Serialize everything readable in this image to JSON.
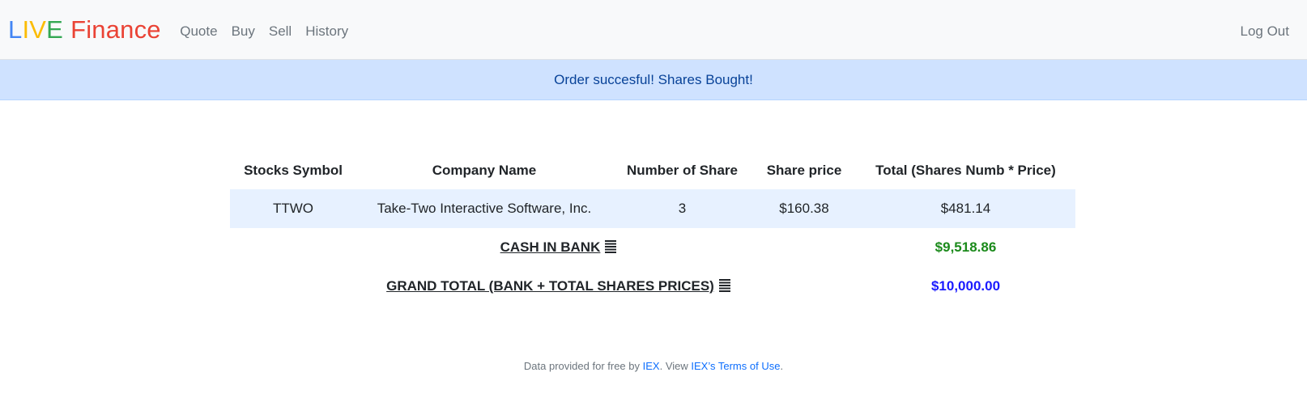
{
  "brand": {
    "letters": [
      "L",
      "I",
      "V",
      "E"
    ],
    "word": "Finance"
  },
  "nav": {
    "items": [
      {
        "label": "Quote"
      },
      {
        "label": "Buy"
      },
      {
        "label": "Sell"
      },
      {
        "label": "History"
      }
    ],
    "logout_label": "Log Out"
  },
  "alert": {
    "message": "Order succesful! Shares Bought!"
  },
  "table": {
    "headers": [
      "Stocks Symbol",
      "Company Name",
      "Number of Share",
      "Share price",
      "Total (Shares Numb * Price)"
    ],
    "rows": [
      {
        "symbol": "TTWO",
        "company": "Take-Two Interactive Software, Inc.",
        "shares": "3",
        "price": "$160.38",
        "total": "$481.14"
      }
    ],
    "cash": {
      "label": "CASH IN BANK",
      "icon": "bars-icon",
      "value": "$9,518.86"
    },
    "grand_total": {
      "label": "GRAND TOTAL (BANK + TOTAL SHARES PRICES)",
      "icon": "bars-icon",
      "value": "$10,000.00"
    }
  },
  "footer": {
    "prefix": "Data provided for free by ",
    "link1": "IEX",
    "middle": ". View ",
    "link2": "IEX’s Terms of Use",
    "suffix": "."
  },
  "colors": {
    "brand_blue": "#4285f4",
    "brand_red": "#ea4335",
    "brand_yellow": "#fbbc05",
    "brand_green": "#34a853",
    "alert_bg": "#cfe2ff",
    "cash_green": "#1b8a1b",
    "total_blue": "#1a1aff",
    "link_blue": "#0d6efd"
  }
}
